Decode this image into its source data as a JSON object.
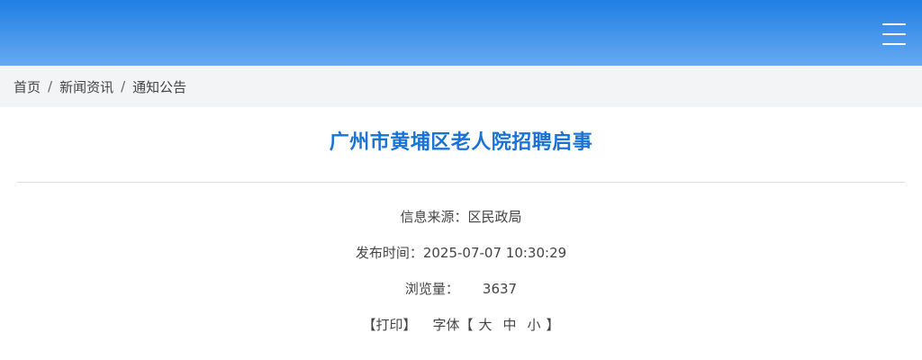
{
  "header": {
    "menu_icon": "hamburger-menu-icon",
    "background_gradient": [
      "#1f7fe3",
      "#66a9f1"
    ]
  },
  "breadcrumb": {
    "items": [
      "首页",
      "新闻资讯",
      "通知公告"
    ],
    "separator": "/"
  },
  "article": {
    "title": "广州市黄埔区老人院招聘启事",
    "title_color": "#1a72d6",
    "source_label": "信息来源：",
    "source_value": "区民政局",
    "time_label": "发布时间：",
    "time_value": "2025-07-07 10:30:29",
    "views_label": "浏览量：",
    "views_value": "3637",
    "print_label": "【打印】",
    "font_label": "字体【",
    "font_large": "大",
    "font_medium": "中",
    "font_small": "小",
    "font_close": "】"
  }
}
